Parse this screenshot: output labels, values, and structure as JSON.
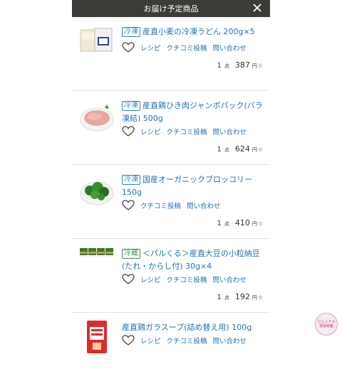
{
  "header": {
    "title": "お届け予定商品",
    "close_icon": "close-icon"
  },
  "items": [
    {
      "badge": "冷凍",
      "name": "産直小麦の冷凍うどん 200g×5",
      "links": {
        "recipe": "レシピ",
        "review": "クチコミ投稿",
        "inquiry": "問い合わせ"
      },
      "qty": "1",
      "qty_unit": "点",
      "price": "387",
      "yen": "円",
      "tax": "☆"
    },
    {
      "badge": "冷凍",
      "name": "産直鶏ひき肉ジャンボパック(バラ凍結) 500g",
      "links": {
        "recipe": "レシピ",
        "review": "クチコミ投稿",
        "inquiry": "問い合わせ"
      },
      "qty": "1",
      "qty_unit": "点",
      "price": "624",
      "yen": "円",
      "tax": "☆"
    },
    {
      "badge": "冷凍",
      "name": "国産オーガニックブロッコリー150g",
      "links": {
        "review": "クチコミ投稿",
        "inquiry": "問い合わせ"
      },
      "qty": "1",
      "qty_unit": "点",
      "price": "410",
      "yen": "円",
      "tax": "☆"
    },
    {
      "badge": "冷蔵",
      "name": "＜パルくる＞産直大豆の小粒納豆(たれ・からし付) 30g×4",
      "links": {
        "recipe": "レシピ",
        "review": "クチコミ投稿",
        "inquiry": "問い合わせ"
      },
      "qty": "1",
      "qty_unit": "点",
      "price": "192",
      "yen": "円",
      "tax": "☆"
    },
    {
      "badge": "",
      "name": "産直鶏ガラスープ(詰め替え用) 100g",
      "links": {
        "recipe": "レシピ",
        "review": "クチコミ投稿",
        "inquiry": "問い合わせ"
      }
    }
  ],
  "overlay": {
    "line1": "ジェンドル",
    "line2": "現役助産"
  },
  "colors": {
    "link": "#2570b8",
    "header_bg": "#3b3b38",
    "frozen_badge": "#2a8cb5",
    "chilled_badge": "#3f8a4c"
  }
}
